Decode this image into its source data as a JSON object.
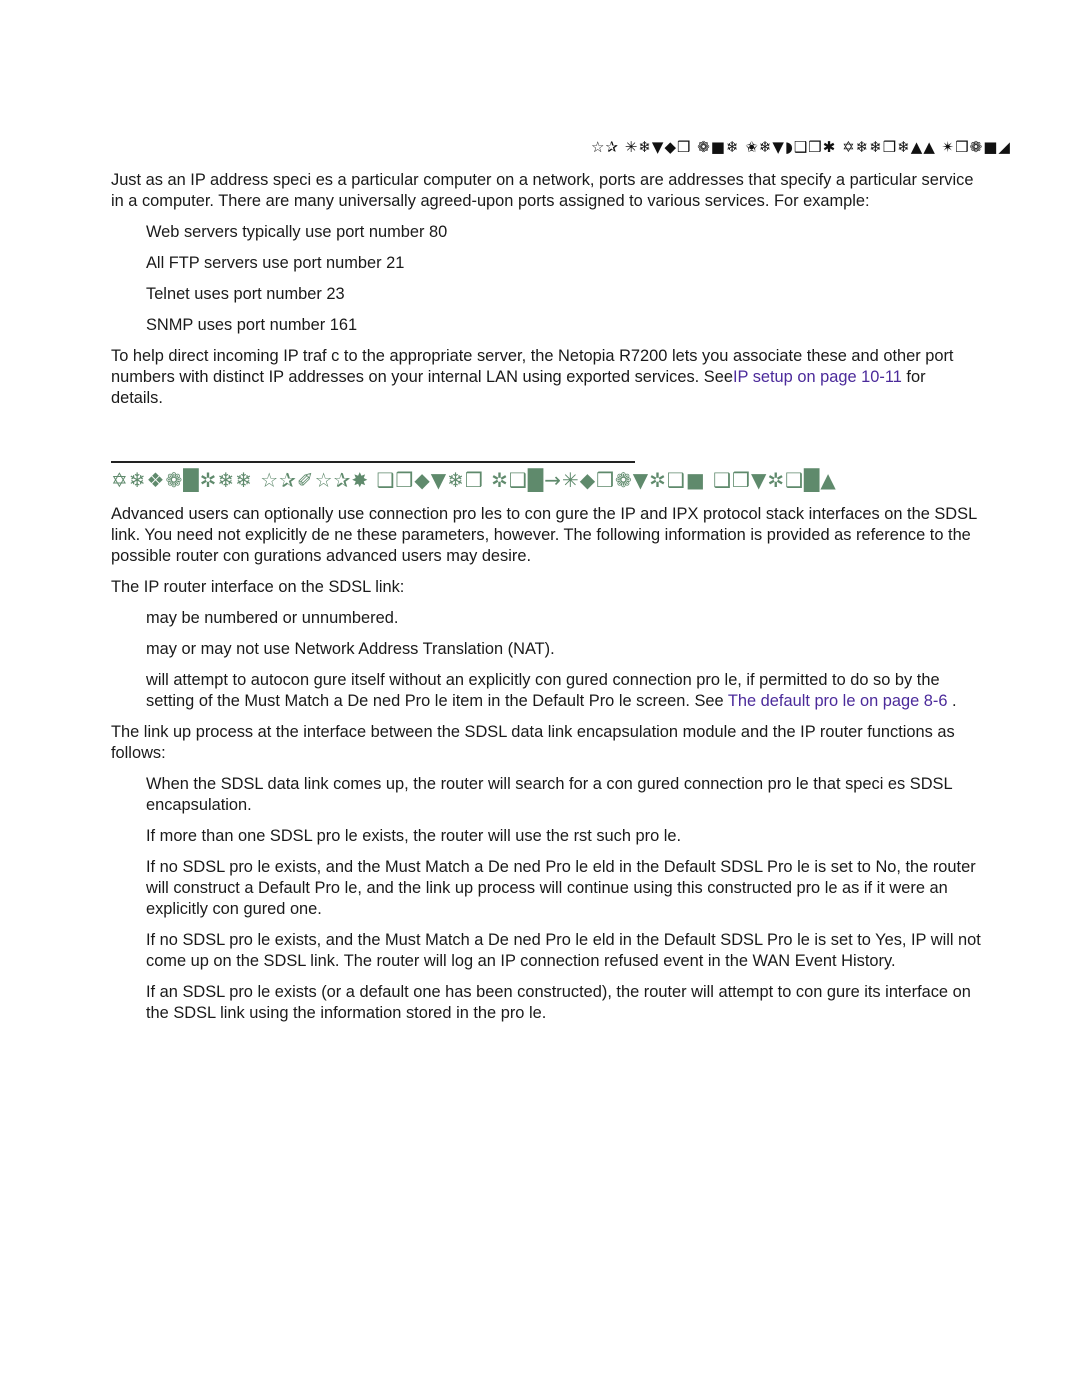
{
  "running_head": "☆✰ ✳❄▼◆❒ ❁■❄ ✬❄▼◗❑❒✱ ✡❄❄❒❄▲▲ ✴❒❁■◢",
  "intro": {
    "paragraph": "Just as an IP address speci es a particular computer on a network, ports are addresses that specify a particular service in a computer. There are many universally agreed-upon ports assigned to various services. For example:",
    "items": [
      "Web servers typically use port number 80",
      "All FTP servers use port number 21",
      "Telnet uses port number 23",
      "SNMP uses port number 161"
    ],
    "help_text_before": "To help direct incoming IP traf c to the appropriate server, the Netopia R7200 lets you associate these and other port numbers with distinct IP addresses on your internal LAN using exported services. See",
    "help_link": "IP setup  on page 10-11",
    "help_text_after": " for details."
  },
  "section": {
    "heading": "✡❄❖❁█✲❄❄ ☆✰✐☆✰✸ ❑❒◆▼❄❒ ✲❑█→✳◆❒❁▼✲❑■ ❑❒▼✲❑█▲",
    "para1": "Advanced users can optionally use connection pro les to con gure the IP and IPX protocol stack interfaces on the SDSL link. You need not explicitly de ne these parameters, however. The following information is provided as reference to the possible router con gurations advanced users may desire.",
    "para2": "The IP router interface on the SDSL link:",
    "items1": [
      "may be numbered or unnumbered.",
      "may or may not use Network Address Translation (NAT)."
    ],
    "item3_text": "will attempt to autocon gure itself without an explicitly con gured connection pro le, if permitted to do so by the setting of the Must Match a De ned Pro le item in the Default Pro le screen. See   ",
    "item3_link": "The default pro le  on page 8-6",
    "item3_after": " .",
    "para3": "The link up process at the interface between the SDSL data link encapsulation module and the IP router functions as follows:",
    "items2": [
      "When the SDSL data link comes up, the router will search for a con gured connection pro le that speci es SDSL encapsulation.",
      "If more than one SDSL pro le exists, the router will use the  rst such pro le.",
      "If no SDSL pro le exists, and the Must Match a De ned Pro le  eld in the Default SDSL Pro le is set to No, the router will construct a Default Pro le, and the link up process will continue using this constructed pro le as if it were an explicitly con gured one.",
      "If no SDSL pro le exists, and the Must Match a De ned Pro le  eld in the Default SDSL Pro le is set to Yes, IP will not come up on the SDSL link. The router will log an  IP connection refused  event in the WAN Event History.",
      "If an SDSL pro le exists (or a default one has been constructed), the router will attempt to con gure its interface on the SDSL link using the information stored in the pro le."
    ]
  },
  "colors": {
    "heading": "#5f8a6c",
    "link": "#4b2a9a",
    "text": "#1a1a1a"
  }
}
